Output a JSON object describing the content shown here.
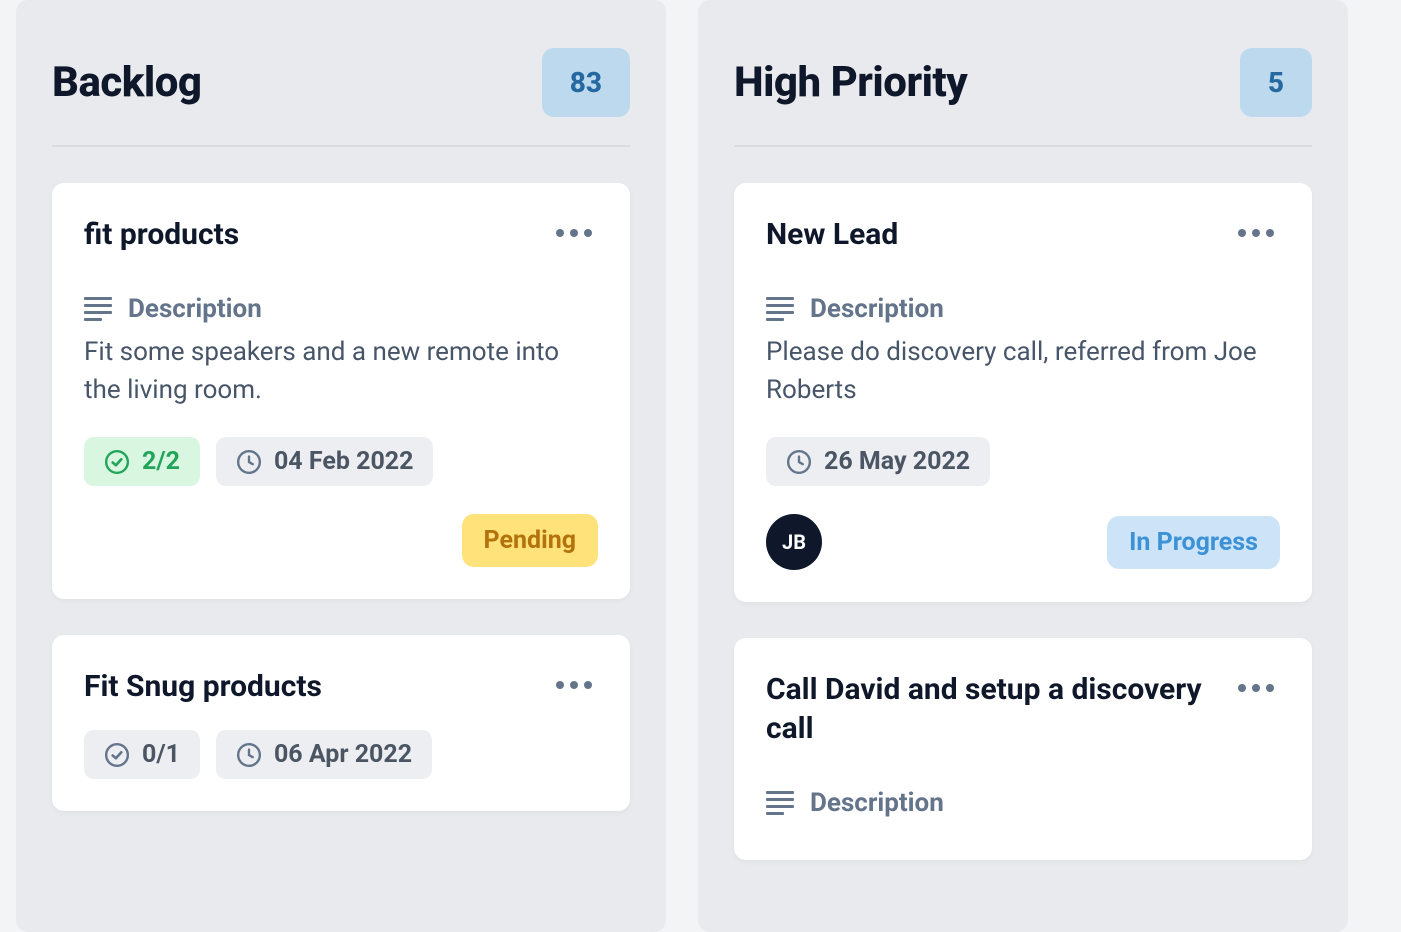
{
  "columns": [
    {
      "title": "Backlog",
      "count": "83",
      "cards": [
        {
          "title": "fit products",
          "desc_label": "Description",
          "description": "Fit some speakers and a new remote into the living room.",
          "progress": "2/2",
          "progress_style": "green",
          "date": "04 Feb 2022",
          "status": "Pending",
          "status_style": "pending",
          "avatar": null
        },
        {
          "title": "Fit Snug products",
          "desc_label": null,
          "description": null,
          "progress": "0/1",
          "progress_style": "gray",
          "date": "06 Apr 2022",
          "status": null,
          "status_style": null,
          "avatar": null
        }
      ]
    },
    {
      "title": "High Priority",
      "count": "5",
      "cards": [
        {
          "title": "New Lead",
          "desc_label": "Description",
          "description": "Please do discovery call, referred from Joe Roberts",
          "progress": null,
          "progress_style": null,
          "date": "26 May 2022",
          "status": "In Progress",
          "status_style": "progress",
          "avatar": "JB"
        },
        {
          "title": "Call David and setup a discovery call",
          "desc_label": "Description",
          "description": null,
          "progress": null,
          "progress_style": null,
          "date": null,
          "status": null,
          "status_style": null,
          "avatar": null
        }
      ]
    }
  ]
}
